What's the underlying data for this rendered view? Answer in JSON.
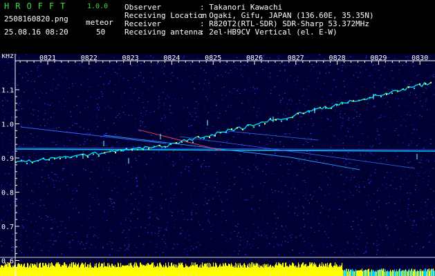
{
  "header": {
    "app_title": "HROFFT",
    "app_version": "1.0.0",
    "file_name": "2508160820.png",
    "date_time": "25.08.16 08:20",
    "meteor_label": "meteor",
    "meteor_count": "50"
  },
  "info": [
    {
      "label": "Observer",
      "value": ": Takanori Kawachi"
    },
    {
      "label": "Receiving Location",
      "value": ": Ogaki, Gifu, JAPAN (136.60E, 35.35N)"
    },
    {
      "label": "Receiver",
      "value": ": R820T2(RTL-SDR) SDR-Sharp 53.372MHz"
    },
    {
      "label": "Receiving antenna",
      "value": ": 2el-HB9CV Vertical (el. E-W)"
    }
  ],
  "chart_data": {
    "type": "heatmap",
    "y_unit": "kHz",
    "y_ticks": [
      "1.1",
      "1.0",
      "0.9",
      "0.8",
      "0.7",
      "0.6"
    ],
    "x_ticks": [
      "0821",
      "0822",
      "0823",
      "0824",
      "0825",
      "0826",
      "0827",
      "0828",
      "0829",
      "0830"
    ]
  },
  "colors": {
    "background_noise": "#0a0a6e",
    "header_label": "#3ddc3d",
    "signal": "#00e6ff",
    "meteor_bar": "#ffff00"
  }
}
